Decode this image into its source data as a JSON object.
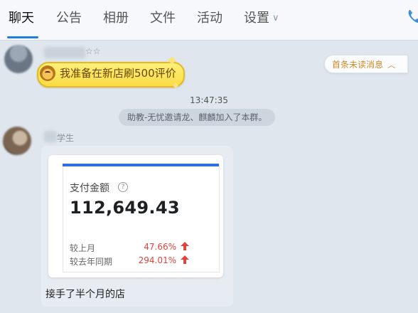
{
  "tabs": [
    {
      "label": "聊天",
      "active": true
    },
    {
      "label": "公告"
    },
    {
      "label": "相册"
    },
    {
      "label": "文件"
    },
    {
      "label": "活动"
    },
    {
      "label": "设置"
    }
  ],
  "icons": {
    "settings_dropdown": "chevron-down-icon",
    "call": "phone-icon",
    "unread": "chevron-up-icon",
    "help": "help-icon",
    "trend": "up-arrow-icon"
  },
  "colors": {
    "accent": "#1f7fe0",
    "highlight_bubble": "#f9dc45",
    "increase": "#e0443a",
    "unread_text": "#c98a2a"
  },
  "messages": {
    "first_sender_suffix": "☆☆",
    "highlight_text": "我准备在新店刷500评价",
    "unread_pill": "首条未读消息",
    "timestamp": "13:47:35",
    "system_notice": "助教-无忧邀请龙、麒麟加入了本群。",
    "second_sender_suffix": "学生",
    "payment_card": {
      "label": "支付金额",
      "amount": "112,649.43",
      "rows": [
        {
          "label": "较上月",
          "value": "47.66%"
        },
        {
          "label": "较去年同期",
          "value": "294.01%"
        }
      ]
    },
    "caption": "接手了半个月的店"
  }
}
